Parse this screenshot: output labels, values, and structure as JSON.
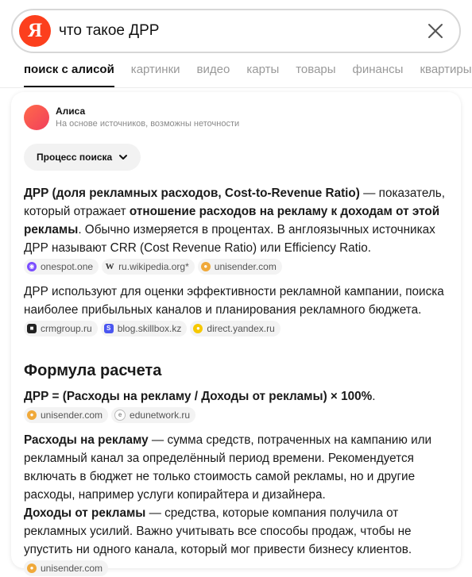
{
  "search": {
    "logo": "Я",
    "query": "что такое ДРР",
    "clear_icon": "close-icon"
  },
  "tabs": [
    {
      "label": "поиск с алисой",
      "active": true
    },
    {
      "label": "картинки"
    },
    {
      "label": "видео"
    },
    {
      "label": "карты"
    },
    {
      "label": "товары"
    },
    {
      "label": "финансы"
    },
    {
      "label": "квартиры"
    }
  ],
  "alice": {
    "name": "Алиса",
    "subtitle": "На основе источников, возможны неточности",
    "process_button": "Процесс поиска"
  },
  "answer": {
    "p1_b1": "ДРР (доля рекламных расходов, Cost-to-Revenue Ratio)",
    "p1_t1": " — показатель, который отражает ",
    "p1_b2": "отношение расходов на рекламу к доходам от этой рекламы",
    "p1_t2": ". Обычно измеряется в процентах. В англоязычных источниках ДРР называют CRR (Cost Revenue Ratio) или Efficiency Ratio. ",
    "p1_sources": [
      "onespot.one",
      "ru.wikipedia.org*",
      "unisender.com"
    ],
    "p2_text": "ДРР используют для оценки эффективности рекламной кампании, поиска наиболее прибыльных каналов и планирования рекламного бюджета. ",
    "p2_sources": [
      "crmgroup.ru",
      "blog.skillbox.kz",
      "direct.yandex.ru"
    ],
    "heading": "Формула расчета",
    "formula": "ДРР = (Расходы на рекламу / Доходы от рекламы) × 100%",
    "formula_end": ".",
    "formula_sources": [
      "unisender.com",
      "edunetwork.ru"
    ],
    "p4_b1": "Расходы на рекламу",
    "p4_t1": " — сумма средств, потраченных на кампанию или рекламный канал за определённый период времени. Рекомендуется включать в бюджет не только стоимость самой рекламы, но и другие расходы, например услуги копирайтера и дизайнера.",
    "p5_b1": "Доходы от рекламы",
    "p5_t1": " — средства, которые компания получила от рекламных усилий. Важно учитывать все способы продаж, чтобы не упустить ни одного канала, который мог привести бизнесу клиентов.",
    "p5_sources": [
      "unisender.com"
    ]
  },
  "colors": {
    "yandex_red": "#fc3f1d",
    "alice_gradient": "#f13f5c"
  }
}
